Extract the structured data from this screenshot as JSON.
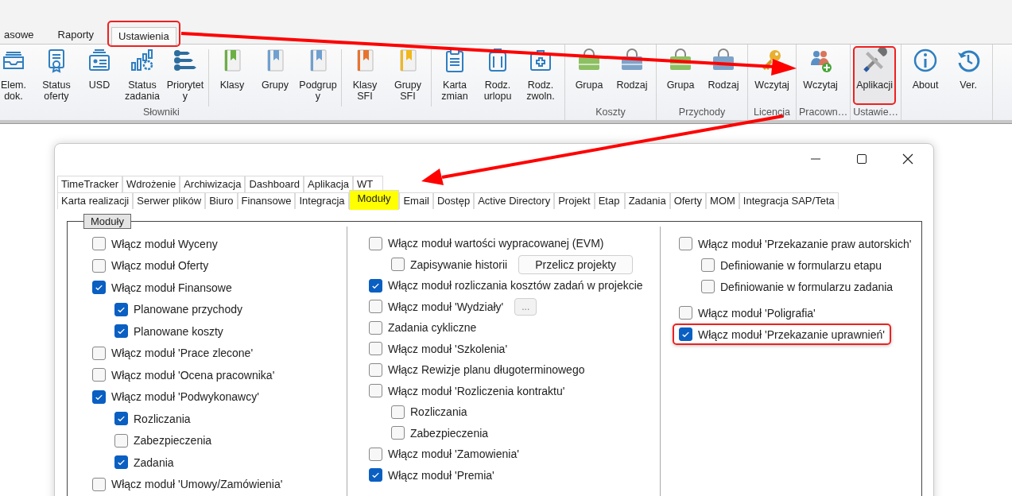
{
  "ribbon": {
    "tabs": [
      {
        "label": "asowe",
        "selected": false,
        "highlighted": false
      },
      {
        "label": "Raporty",
        "selected": false,
        "highlighted": false
      },
      {
        "label": "Ustawienia",
        "selected": true,
        "highlighted": true
      }
    ],
    "groups": [
      {
        "label": "Słowniki",
        "sections": [
          [
            {
              "lines": [
                "Elem.",
                "dok."
              ],
              "highlighted": false
            },
            {
              "lines": [
                "Status",
                "oferty"
              ],
              "highlighted": false
            },
            {
              "lines": [
                "USD"
              ],
              "highlighted": false
            },
            {
              "lines": [
                "Status",
                "zadania"
              ],
              "highlighted": false
            },
            {
              "lines": [
                "Priorytet",
                "y"
              ],
              "highlighted": false
            }
          ],
          [
            {
              "lines": [
                "Klasy"
              ],
              "highlighted": false
            },
            {
              "lines": [
                "Grupy"
              ],
              "highlighted": false
            },
            {
              "lines": [
                "Podgrup",
                "y"
              ],
              "highlighted": false
            }
          ],
          [
            {
              "lines": [
                "Klasy",
                "SFI"
              ],
              "highlighted": false
            },
            {
              "lines": [
                "Grupy",
                "SFI"
              ],
              "highlighted": false
            }
          ],
          [
            {
              "lines": [
                "Karta",
                "zmian"
              ],
              "highlighted": false
            },
            {
              "lines": [
                "Rodz.",
                "urlopu"
              ],
              "highlighted": false
            },
            {
              "lines": [
                "Rodz.",
                "zwoln."
              ],
              "highlighted": false
            }
          ]
        ]
      },
      {
        "label": "Koszty",
        "sections": [
          [
            {
              "lines": [
                "Grupa"
              ],
              "highlighted": false
            },
            {
              "lines": [
                "Rodzaj"
              ],
              "highlighted": false
            }
          ]
        ]
      },
      {
        "label": "Przychody",
        "sections": [
          [
            {
              "lines": [
                "Grupa"
              ],
              "highlighted": false
            },
            {
              "lines": [
                "Rodzaj"
              ],
              "highlighted": false
            }
          ]
        ]
      },
      {
        "label": "Licencja",
        "sections": [
          [
            {
              "lines": [
                "Wczytaj"
              ],
              "highlighted": false
            }
          ]
        ]
      },
      {
        "label": "Pracown…",
        "sections": [
          [
            {
              "lines": [
                "Wczytaj"
              ],
              "highlighted": false
            }
          ]
        ]
      },
      {
        "label": "Ustawie…",
        "sections": [
          [
            {
              "lines": [
                "Aplikacji"
              ],
              "highlighted": true
            }
          ]
        ]
      },
      {
        "sections": [
          [
            {
              "lines": [
                "About"
              ],
              "highlighted": false
            },
            {
              "lines": [
                "Ver."
              ],
              "highlighted": false
            }
          ]
        ]
      }
    ]
  },
  "dialog": {
    "tab_rows": [
      [
        {
          "label": "TimeTracker",
          "selected": false
        },
        {
          "label": "Wdrożenie",
          "selected": false
        },
        {
          "label": "Archiwizacja",
          "selected": false
        },
        {
          "label": "Dashboard",
          "selected": false
        },
        {
          "label": "Aplikacja",
          "selected": false
        },
        {
          "label": "WT",
          "selected": false
        }
      ],
      [
        {
          "label": "Karta realizacji",
          "selected": false
        },
        {
          "label": "Serwer plików",
          "selected": false
        },
        {
          "label": "Biuro",
          "selected": false
        },
        {
          "label": "Finansowe",
          "selected": false
        },
        {
          "label": "Integracja",
          "selected": false
        },
        {
          "label": "Moduły",
          "selected": true
        },
        {
          "label": "Email",
          "selected": false
        },
        {
          "label": "Dostęp",
          "selected": false
        },
        {
          "label": "Active Directory",
          "selected": false
        },
        {
          "label": "Projekt",
          "selected": false
        },
        {
          "label": "Etap",
          "selected": false
        },
        {
          "label": "Zadania",
          "selected": false
        },
        {
          "label": "Oferty",
          "selected": false
        },
        {
          "label": "MOM",
          "selected": false
        },
        {
          "label": "Integracja SAP/Teta",
          "selected": false
        }
      ]
    ],
    "group_title": "Moduły",
    "columns": [
      [
        {
          "label": "Włącz moduł Wyceny",
          "checked": false,
          "highlighted": false
        },
        {
          "label": "Włącz moduł Oferty",
          "checked": false,
          "highlighted": false
        },
        {
          "label": "Włącz moduł Finansowe",
          "checked": true,
          "highlighted": false,
          "children": [
            {
              "label": "Planowane przychody",
              "checked": true,
              "highlighted": false
            },
            {
              "label": "Planowane koszty",
              "checked": true,
              "highlighted": false
            }
          ]
        },
        {
          "label": "Włącz moduł 'Prace zlecone'",
          "checked": false,
          "highlighted": false
        },
        {
          "label": "Włącz moduł 'Ocena pracownika'",
          "checked": false,
          "highlighted": false
        },
        {
          "label": "Włącz moduł 'Podwykonawcy'",
          "checked": true,
          "highlighted": false,
          "children": [
            {
              "label": "Rozliczania",
              "checked": true,
              "highlighted": false
            },
            {
              "label": "Zabezpieczenia",
              "checked": false,
              "highlighted": false
            },
            {
              "label": "Zadania",
              "checked": true,
              "highlighted": false
            }
          ]
        },
        {
          "label": "Włącz moduł 'Umowy/Zamówienia'",
          "checked": false,
          "highlighted": false
        }
      ],
      [
        {
          "label": "Włącz moduł wartości wypracowanej (EVM)",
          "checked": false,
          "highlighted": false,
          "children": [
            {
              "label": "Zapisywanie historii",
              "checked": false,
              "highlighted": false,
              "button": "Przelicz projekty"
            }
          ]
        },
        {
          "label": "Włącz moduł rozliczania kosztów zadań w projekcie",
          "checked": true,
          "highlighted": false
        },
        {
          "label": "Włącz moduł 'Wydziały'",
          "checked": false,
          "highlighted": false,
          "button": "..."
        },
        {
          "label": "Zadania cykliczne",
          "checked": false,
          "highlighted": false
        },
        {
          "label": "Włącz moduł 'Szkolenia'",
          "checked": false,
          "highlighted": false
        },
        {
          "label": "Włącz Rewizje planu długoterminowego",
          "checked": false,
          "highlighted": false
        },
        {
          "label": "Włącz moduł 'Rozliczenia kontraktu'",
          "checked": false,
          "highlighted": false,
          "children": [
            {
              "label": "Rozliczania",
              "checked": false,
              "highlighted": false
            },
            {
              "label": "Zabezpieczenia",
              "checked": false,
              "highlighted": false
            }
          ]
        },
        {
          "label": "Włącz moduł 'Zamowienia'",
          "checked": false,
          "highlighted": false
        },
        {
          "label": "Włącz moduł 'Premia'",
          "checked": true,
          "highlighted": false
        }
      ],
      [
        {
          "label": "Włącz moduł 'Przekazanie praw autorskich'",
          "checked": false,
          "highlighted": false,
          "children": [
            {
              "label": "Definiowanie w formularzu etapu",
              "checked": false,
              "highlighted": false
            },
            {
              "label": "Definiowanie w formularzu zadania",
              "checked": false,
              "highlighted": false
            }
          ]
        },
        {
          "label": "Włącz moduł 'Poligrafia'",
          "checked": false,
          "highlighted": false
        },
        {
          "label": "Włącz moduł 'Przekazanie uprawnień'",
          "checked": true,
          "highlighted": true
        }
      ]
    ]
  }
}
